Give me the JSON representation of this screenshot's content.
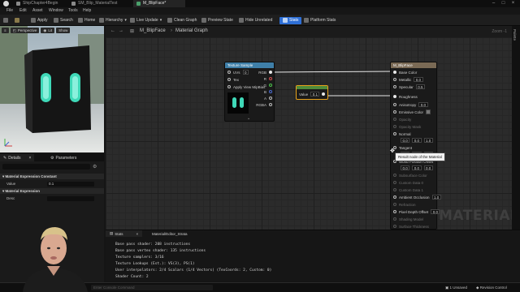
{
  "titlebar": {
    "tabs": [
      {
        "label": "ShipChapter4Begin"
      },
      {
        "label": "SM_Blip_MaterialTest"
      },
      {
        "label": "M_BlipFace*"
      }
    ]
  },
  "menu": {
    "items": [
      "File",
      "Edit",
      "Asset",
      "Window",
      "Tools",
      "Help"
    ]
  },
  "toolbar": {
    "save": "Save",
    "apply": "Apply",
    "search": "Search",
    "home": "Home",
    "hierarchy": "Hierarchy",
    "live_update": "Live Update",
    "clean_graph": "Clean Graph",
    "preview_state": "Preview State",
    "hide_unrelated": "Hide Unrelated",
    "stats": "Stats",
    "platform_stats": "Platform Stats"
  },
  "viewport": {
    "perspective": "Perspective",
    "lit": "Lit",
    "show": "Show"
  },
  "details": {
    "tab_details": "Details",
    "tab_parameters": "Parameters",
    "section_constant": "Material Expression Constant",
    "value_label": "Value",
    "value": "0.1",
    "section_expression": "Material Expression",
    "desc_label": "Desc"
  },
  "graph": {
    "title": "M_BlipFace",
    "subtitle": "Material Graph",
    "zoom": "Zoom -1",
    "palette": "Palette",
    "watermark": "MATERIAL",
    "tooltip": "Result node of the Material"
  },
  "texture_sample": {
    "title": "Texture Sample",
    "inputs": [
      "UVs",
      "Tex",
      "Apply View MipBias"
    ],
    "uv_value": "0",
    "outputs": [
      "RGB",
      "R",
      "G",
      "B",
      "A",
      "RGBA"
    ]
  },
  "constant_node": {
    "value_label": "Value",
    "value": "0.1"
  },
  "result_node": {
    "title": "M_BlipFace",
    "pins": [
      {
        "label": "Base Color"
      },
      {
        "label": "Metallic",
        "value": "0.0"
      },
      {
        "label": "Specular",
        "value": "0.5"
      },
      {
        "label": "Roughness"
      },
      {
        "label": "Anisotropy",
        "value": "0.0"
      },
      {
        "label": "Emissive Color"
      },
      {
        "label": "Opacity"
      },
      {
        "label": "Opacity Mask"
      },
      {
        "label": "Normal",
        "v1": "0.0",
        "v2": "0.0",
        "v3": "1.0"
      },
      {
        "label": "Tangent",
        "v1": "1.0",
        "v2": "0.0",
        "v3": "0.0"
      },
      {
        "label": "World Position Offset",
        "v1": "0.0",
        "v2": "0.0",
        "v3": "0.0"
      },
      {
        "label": "Subsurface Color"
      },
      {
        "label": "Custom Data 0"
      },
      {
        "label": "Custom Data 1"
      },
      {
        "label": "Ambient Occlusion",
        "value": "1.0"
      },
      {
        "label": "Refraction"
      },
      {
        "label": "Pixel Depth Offset",
        "value": "0.0"
      },
      {
        "label": "Shading Model"
      },
      {
        "label": "Surface Thickness"
      }
    ]
  },
  "stats": {
    "tab_stats": "Stats",
    "tab_substrate": "Material/Editor_Strata",
    "lines": [
      "Base pass shader: 208 instructions",
      "Base pass vertex shader: 135 instructions",
      "Texture samplers: 3/16",
      "Texture Lookups (Est.): VS(3), PS(1)",
      "User interpolators: 2/4 Scalars (1/4 Vectors) (TexCoords: 2, Custom: 0)",
      "Shader Count: 2"
    ]
  },
  "bottombar": {
    "cmd_placeholder": "Enter Console Command",
    "unsaved": "1 Unsaved",
    "revision": "Revision Control"
  },
  "colors": {
    "accent": "#2e6fd6",
    "texture_header": "#3f7fa8",
    "constant_header": "#4f8a3a",
    "result_header": "#7a6a55",
    "selection": "#e8a21a",
    "emissive": "#3fd9b8"
  }
}
